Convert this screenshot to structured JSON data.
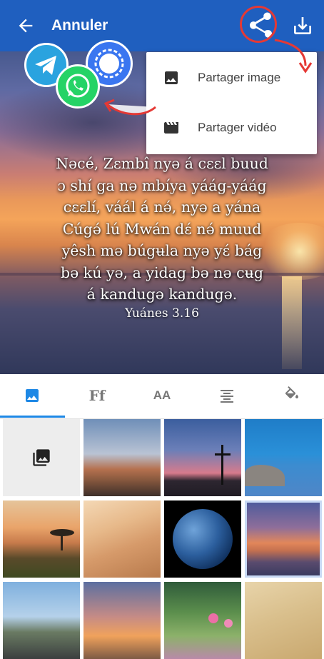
{
  "topbar": {
    "back_icon": "arrow-left-icon",
    "title": "Annuler",
    "share_icon": "share-icon",
    "download_icon": "download-icon",
    "color": "#1f5fbf"
  },
  "verse": {
    "lines": [
      "Nəcé, Zɛmbî nyə á cɛɛl buud",
      "ɔ shí ga nə mbíya yáág-yáág",
      "cɛɛlí, váál á nə́, nyə a yána",
      "Cúgə́ lú Mwán dɛ́ nə́ muud",
      "yêsh mə búgʉla nyə yɛ́ bág",
      "bə kú yə, a yidag bə nə cʉg",
      "á kandugə kandugə."
    ],
    "reference": "Yuánes 3.16"
  },
  "share_menu": {
    "items": [
      {
        "icon": "image-icon",
        "label": "Partager image"
      },
      {
        "icon": "video-icon",
        "label": "Partager vidéo"
      }
    ]
  },
  "share_apps": [
    "telegram-icon",
    "whatsapp-icon",
    "signal-icon"
  ],
  "tabs": [
    {
      "icon": "image-icon",
      "selected": true
    },
    {
      "icon": "font-icon",
      "text": "Ff"
    },
    {
      "icon": "text-size-icon",
      "text": "AA"
    },
    {
      "icon": "align-center-icon"
    },
    {
      "icon": "paint-bucket-icon"
    }
  ],
  "accent_color": "#1e88e5",
  "backgrounds": [
    "gallery-picker-icon",
    "desert-mountains",
    "cross-sunset",
    "rocky-sea",
    "savanna-tree-sunset",
    "sand-dunes",
    "earth-globe",
    "sea-sunset",
    "road-landscape",
    "mountain-sunset",
    "pink-flowers",
    "wheat-field"
  ]
}
